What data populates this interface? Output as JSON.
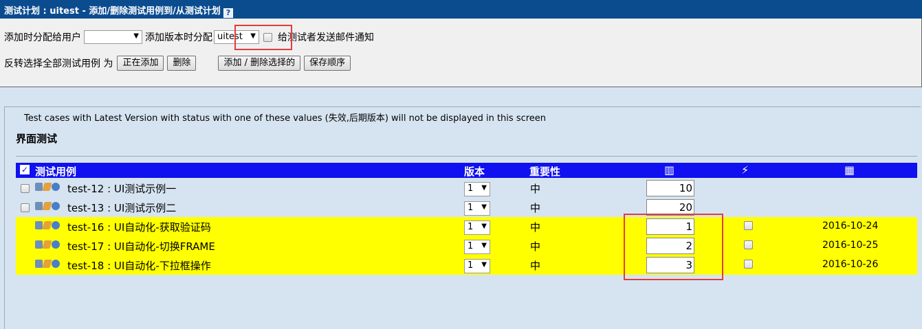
{
  "titlebar": {
    "title": "测试计划 : uitest - 添加/删除测试用例到/从测试计划",
    "help_glyph": "?"
  },
  "controls": {
    "assign_user_label": "添加时分配给用户",
    "assign_user_value": "",
    "build_label": "添加版本时分配",
    "build_value": "uitest",
    "notify_label": "给测试者发送邮件通知",
    "toggle_label": "反转选择全部测试用例 为",
    "adding_button": "正在添加",
    "delete_button": "删除",
    "add_remove_button": "添加 / 删除选择的",
    "save_order_button": "保存顺序"
  },
  "main": {
    "note": "Test cases with Latest Version with status with one of these values (失效,后期版本) will not be displayed in this screen",
    "section_title": "界面测试",
    "headers": {
      "checkbox_glyph": "✓",
      "test_case": "测试用例",
      "version": "版本",
      "importance": "重要性",
      "order_icon": "order-columns-icon",
      "urgency_icon": "plug-icon",
      "date_icon": "calendar-icon"
    },
    "rows": [
      {
        "name": "test-12 : UI测试示例一",
        "version": "1",
        "importance": "中",
        "order": "10",
        "date": "",
        "highlight": false
      },
      {
        "name": "test-13 : UI测试示例二",
        "version": "1",
        "importance": "中",
        "order": "20",
        "date": "",
        "highlight": false
      },
      {
        "name": "test-16 : UI自动化-获取验证码",
        "version": "1",
        "importance": "中",
        "order": "1",
        "date": "2016-10-24",
        "highlight": true
      },
      {
        "name": "test-17 : UI自动化-切换FRAME",
        "version": "1",
        "importance": "中",
        "order": "2",
        "date": "2016-10-25",
        "highlight": true
      },
      {
        "name": "test-18 : UI自动化-下拉框操作",
        "version": "1",
        "importance": "中",
        "order": "3",
        "date": "2016-10-26",
        "highlight": true
      }
    ]
  },
  "colors": {
    "titlebar": "#0b4c8f",
    "table_header": "#1010f0",
    "added_row": "#ffff00",
    "annotation_box": "#e23b3b"
  }
}
